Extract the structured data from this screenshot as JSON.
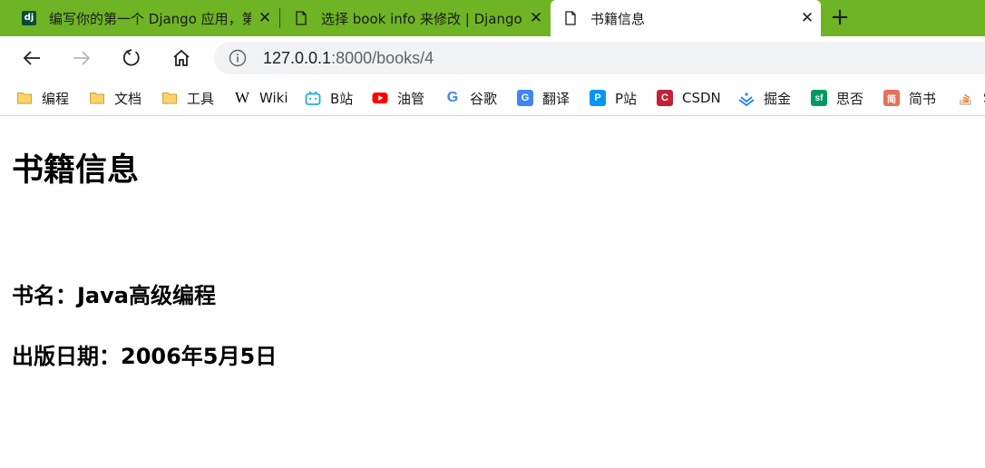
{
  "tabs": [
    {
      "title": "编写你的第一个 Django 应用，第",
      "icon": "django-icon",
      "close": "✕"
    },
    {
      "title": "选择 book info 来修改 | Django 站",
      "icon": "page-icon",
      "close": "✕"
    },
    {
      "title": "书籍信息",
      "icon": "page-icon",
      "close": "✕"
    }
  ],
  "new_tab": "+",
  "address": {
    "host": "127.0.0.1",
    "rest": ":8000/books/4"
  },
  "bookmarks": [
    {
      "label": "编程",
      "icon": "folder-icon"
    },
    {
      "label": "文档",
      "icon": "folder-icon"
    },
    {
      "label": "工具",
      "icon": "folder-icon"
    },
    {
      "label": "Wiki",
      "icon": "wikipedia-icon",
      "glyph": "W"
    },
    {
      "label": "B站",
      "icon": "bilibili-icon",
      "color": "#23ade5"
    },
    {
      "label": "油管",
      "icon": "youtube-icon",
      "color": "#ff0000"
    },
    {
      "label": "谷歌",
      "icon": "google-icon",
      "glyph": "G"
    },
    {
      "label": "翻译",
      "icon": "translate-icon",
      "color": "#4285f4",
      "glyph": "G"
    },
    {
      "label": "P站",
      "icon": "pixiv-icon",
      "color": "#0096fa",
      "glyph": "P"
    },
    {
      "label": "CSDN",
      "icon": "csdn-icon",
      "color": "#c32136",
      "glyph": "C"
    },
    {
      "label": "掘金",
      "icon": "juejin-icon",
      "color": "#1e80ff"
    },
    {
      "label": "思否",
      "icon": "segmentfault-icon",
      "color": "#009a61",
      "glyph": "sf"
    },
    {
      "label": "简书",
      "icon": "jianshu-icon",
      "color": "#ea6f5a",
      "glyph": "简"
    },
    {
      "label": "S",
      "icon": "stackoverflow-icon",
      "color": "#f48024"
    }
  ],
  "page": {
    "title": "书籍信息",
    "book_name": "书名：Java高级编程",
    "publish_date": "出版日期：2006年5月5日"
  },
  "colors": {
    "tabstrip": "#6fb424",
    "active_tab": "#ffffff"
  }
}
